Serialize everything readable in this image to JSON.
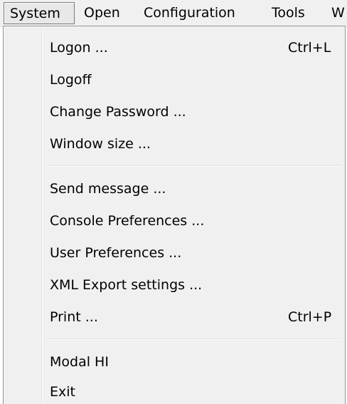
{
  "menubar": {
    "items": [
      {
        "label": "System"
      },
      {
        "label": "Open"
      },
      {
        "label": "Configuration"
      },
      {
        "label": "Tools"
      },
      {
        "label": "W"
      }
    ]
  },
  "dropdown": {
    "items": [
      {
        "label": "Logon ...",
        "shortcut": "Ctrl+L"
      },
      {
        "label": "Logoff",
        "shortcut": ""
      },
      {
        "label": "Change Password ...",
        "shortcut": ""
      },
      {
        "label": "Window size ...",
        "shortcut": ""
      },
      {
        "label": "Send message ...",
        "shortcut": ""
      },
      {
        "label": "Console Preferences ...",
        "shortcut": ""
      },
      {
        "label": "User Preferences ...",
        "shortcut": ""
      },
      {
        "label": "XML Export settings ...",
        "shortcut": ""
      },
      {
        "label": "Print ...",
        "shortcut": "Ctrl+P"
      },
      {
        "label": "Modal HI",
        "shortcut": ""
      },
      {
        "label": "Exit",
        "shortcut": ""
      }
    ]
  }
}
